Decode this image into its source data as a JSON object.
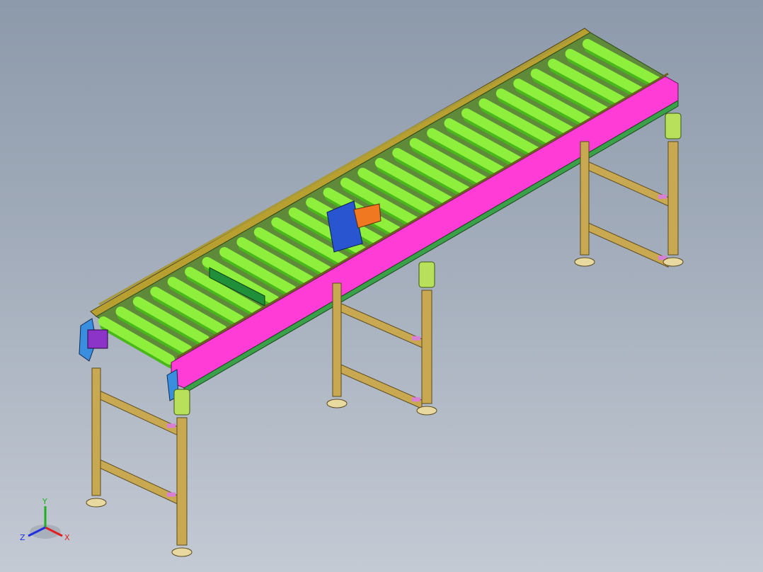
{
  "view": {
    "background_top": "#8d9aab",
    "background_bottom": "#c4cad4"
  },
  "model": {
    "name": "roller-conveyor",
    "roller_count": 29,
    "leg_stand_count": 3,
    "colors": {
      "roller": "#8ef03c",
      "roller_dark": "#49b81a",
      "side_rail_near": "#ff3cd6",
      "side_rail_far": "#b8a030",
      "guide_rail": "#a89a3a",
      "frame": "#c8a850",
      "frame_dark": "#5a4a20",
      "brace": "#d97fd6",
      "bracket": "#b8e05a",
      "end_cap": "#3a8ee0",
      "motor": "#8c33c8",
      "sensor_green": "#1f8f3a",
      "box_blue": "#2a55d0",
      "box_orange": "#f07820",
      "foot": "#e8d9a0"
    }
  },
  "triad": {
    "x_label": "X",
    "y_label": "Y",
    "z_label": "Z",
    "x_color": "#e02020",
    "y_color": "#20b020",
    "z_color": "#2030e0"
  }
}
